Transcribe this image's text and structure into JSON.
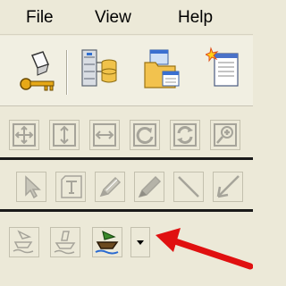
{
  "menu": {
    "file": "File",
    "view": "View",
    "help": "Help"
  },
  "toolbar_main": {
    "icons": [
      "key-user-icon",
      "database-icon",
      "folder-window-icon",
      "new-document-icon"
    ]
  },
  "toolbar_view": {
    "icons": [
      "move-all-icon",
      "resize-vertical-icon",
      "resize-horizontal-icon",
      "rotate-icon",
      "refresh-icon",
      "zoom-icon"
    ]
  },
  "toolbar_draw": {
    "icons": [
      "pointer-icon",
      "text-tool-icon",
      "pen-icon",
      "pencil-icon",
      "line-icon",
      "arrow-line-icon"
    ]
  },
  "toolbar_bottom": {
    "icons": [
      "boat-disabled-icon",
      "boat-disabled-icon",
      "boat-icon",
      "dropdown-arrow-icon"
    ]
  },
  "colors": {
    "annotation_arrow": "#e01010",
    "toolbar_bg": "#ece9d8",
    "disabled_icon": "#a6a49a"
  }
}
